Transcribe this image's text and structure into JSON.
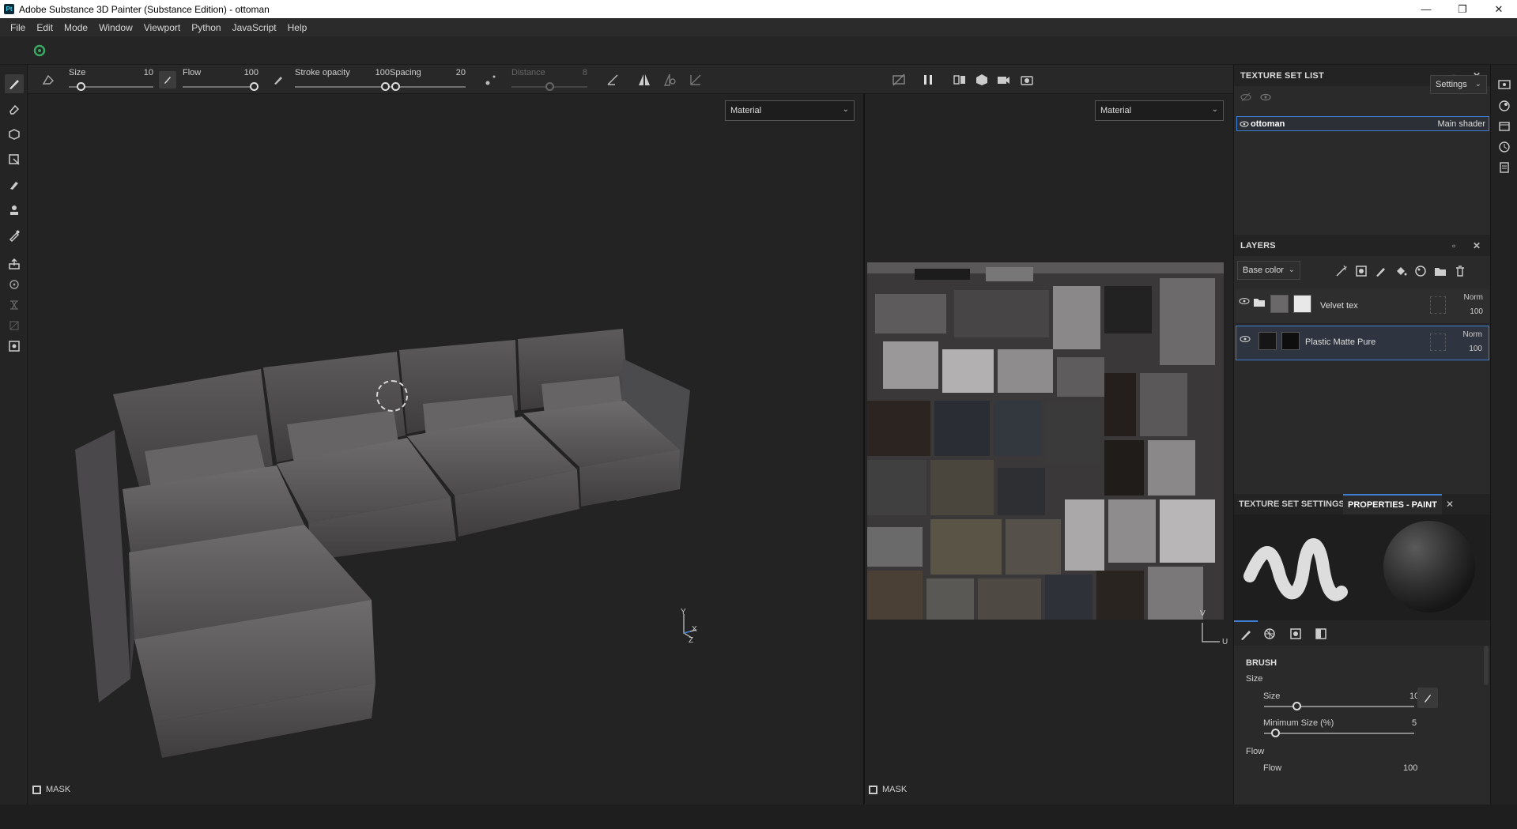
{
  "window": {
    "app_icon": "Pt",
    "title": "Adobe Substance 3D Painter (Substance Edition) - ottoman",
    "minimize": "—",
    "maximize": "❐",
    "close": "✕"
  },
  "menu": [
    "File",
    "Edit",
    "Mode",
    "Window",
    "Viewport",
    "Python",
    "JavaScript",
    "Help"
  ],
  "brush_params": {
    "size": {
      "label": "Size",
      "value": "10",
      "fraction": 0.1
    },
    "flow": {
      "label": "Flow",
      "value": "100",
      "fraction": 1.0
    },
    "stroke_opacity": {
      "label": "Stroke opacity",
      "value": "100",
      "fraction": 1.0
    },
    "spacing": {
      "label": "Spacing",
      "value": "20",
      "fraction": 0.02
    },
    "distance": {
      "label": "Distance",
      "value": "8",
      "fraction": 0.5
    }
  },
  "viewport3d": {
    "mode_select": "Material",
    "mask_label": "MASK",
    "axes": {
      "y": "Y",
      "x": "X",
      "z": "Z"
    }
  },
  "viewport2d": {
    "mode_select": "Material",
    "mask_label": "MASK",
    "axes": {
      "v": "V",
      "u": "U"
    }
  },
  "texture_set_list": {
    "title": "TEXTURE SET LIST",
    "settings_label": "Settings",
    "items": [
      {
        "name": "ottoman",
        "shader": "Main shader"
      }
    ]
  },
  "layers": {
    "title": "LAYERS",
    "channel_select": "Base color",
    "items": [
      {
        "name": "Velvet tex",
        "blend": "Norm",
        "opacity": "100",
        "type": "folder"
      },
      {
        "name": "Plastic Matte Pure",
        "blend": "Norm",
        "opacity": "100",
        "type": "fill",
        "selected": true
      }
    ]
  },
  "properties": {
    "tabs": [
      "TEXTURE SET SETTINGS",
      "PROPERTIES - PAINT"
    ],
    "section": "BRUSH",
    "size_group": "Size",
    "size": {
      "label": "Size",
      "value": "10",
      "fraction": 0.2
    },
    "min_size": {
      "label": "Minimum Size (%)",
      "value": "5",
      "fraction": 0.05
    },
    "flow_group": "Flow",
    "flow": {
      "label": "Flow",
      "value": "100",
      "fraction": 1.0
    }
  },
  "colors": {
    "accent": "#3c7fd4",
    "panel": "#2a2a2a",
    "viewport": "#232323"
  }
}
